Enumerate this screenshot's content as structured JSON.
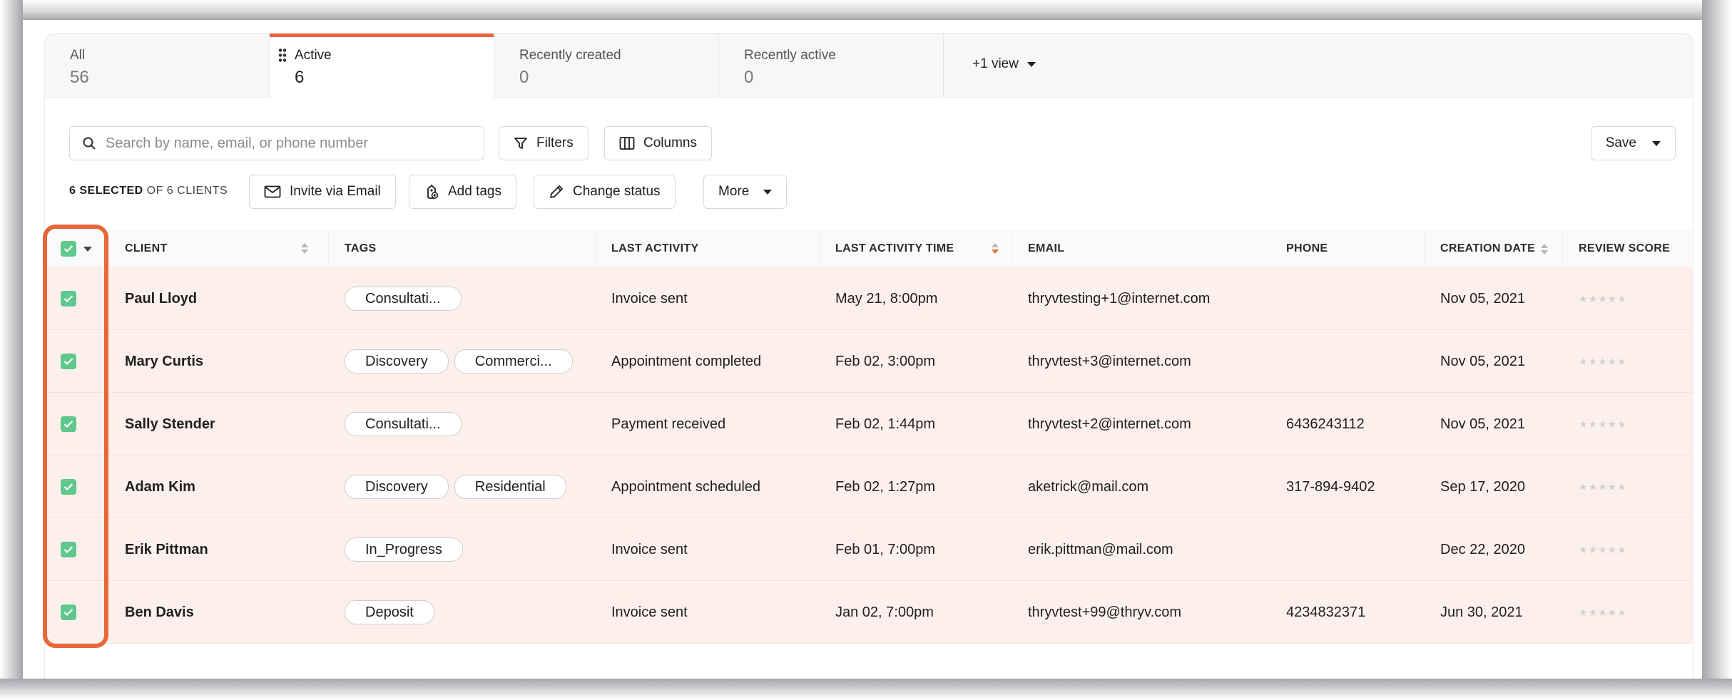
{
  "tabs": [
    {
      "label": "All",
      "count": "56"
    },
    {
      "label": "Active",
      "count": "6"
    },
    {
      "label": "Recently created",
      "count": "0"
    },
    {
      "label": "Recently active",
      "count": "0"
    }
  ],
  "view_selector": {
    "label": "+1 view"
  },
  "search": {
    "placeholder": "Search by name, email, or phone number"
  },
  "toolbar": {
    "filters_label": "Filters",
    "columns_label": "Columns",
    "save_label": "Save"
  },
  "bulk": {
    "selected_count": "6 SELECTED",
    "selected_total": " OF 6 CLIENTS",
    "invite_label": "Invite via Email",
    "tags_label": "Add tags",
    "status_label": "Change status",
    "more_label": "More"
  },
  "table": {
    "headers": {
      "client": "CLIENT",
      "tags": "TAGS",
      "last_activity": "LAST ACTIVITY",
      "last_activity_time": "LAST ACTIVITY TIME",
      "email": "EMAIL",
      "phone": "PHONE",
      "creation_date": "CREATION DATE",
      "review_score": "REVIEW SCORE"
    },
    "rows": [
      {
        "client": "Paul Lloyd",
        "tags": [
          "Consultati..."
        ],
        "activity": "Invoice sent",
        "time": "May 21, 8:00pm",
        "email": "thryvtesting+1@internet.com",
        "phone": "",
        "created": "Nov 05, 2021",
        "stars": "★★★★★"
      },
      {
        "client": "Mary Curtis",
        "tags": [
          "Discovery",
          "Commerci..."
        ],
        "activity": "Appointment completed",
        "time": "Feb 02, 3:00pm",
        "email": "thryvtest+3@internet.com",
        "phone": "",
        "created": "Nov 05, 2021",
        "stars": "★★★★★"
      },
      {
        "client": "Sally Stender",
        "tags": [
          "Consultati..."
        ],
        "activity": "Payment received",
        "time": "Feb 02, 1:44pm",
        "email": "thryvtest+2@internet.com",
        "phone": "6436243112",
        "created": "Nov 05, 2021",
        "stars": "★★★★★"
      },
      {
        "client": "Adam Kim",
        "tags": [
          "Discovery",
          "Residential"
        ],
        "activity": "Appointment scheduled",
        "time": "Feb 02, 1:27pm",
        "email": "aketrick@mail.com",
        "phone": "317-894-9402",
        "created": "Sep 17, 2020",
        "stars": "★★★★★"
      },
      {
        "client": "Erik Pittman",
        "tags": [
          "In_Progress"
        ],
        "activity": "Invoice sent",
        "time": "Feb 01, 7:00pm",
        "email": "erik.pittman@mail.com",
        "phone": "",
        "created": "Dec 22, 2020",
        "stars": "★★★★★"
      },
      {
        "client": "Ben Davis",
        "tags": [
          "Deposit"
        ],
        "activity": "Invoice sent",
        "time": "Jan 02, 7:00pm",
        "email": "thryvtest+99@thryv.com",
        "phone": "4234832371",
        "created": "Jun 30, 2021",
        "stars": "★★★★★"
      }
    ]
  },
  "colors": {
    "accent": "#e8673a",
    "checkbox": "#5ec88d",
    "row_selected": "#fdf0ec"
  }
}
